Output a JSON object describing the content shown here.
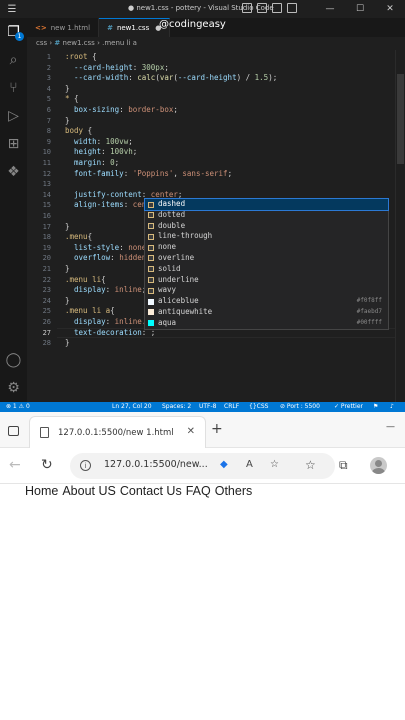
{
  "vscode": {
    "title": "● new1.css - pottery - Visual Studio Code",
    "tabs": [
      {
        "name": "new 1.html",
        "active": false
      },
      {
        "name": "new1.css",
        "active": true
      }
    ],
    "overlay_handle": "@codingeasy",
    "breadcrumb": [
      "css",
      "new1.css",
      ".menu li a"
    ],
    "lines": [
      {
        "n": "1",
        "html": "<span class='sel'>:root</span> <span class='w'>{</span>"
      },
      {
        "n": "2",
        "html": "  <span class='p'>--card-height</span><span class='w'>: </span><span class='n'>300px</span><span class='w'>;</span>"
      },
      {
        "n": "3",
        "html": "  <span class='p'>--card-width</span><span class='w'>: </span><span class='f'>calc</span><span class='w'>(</span><span class='f'>var</span><span class='w'>(</span><span class='p'>--card-height</span><span class='w'>) / </span><span class='n'>1.5</span><span class='w'>);</span>"
      },
      {
        "n": "4",
        "html": "<span class='w'>}</span>"
      },
      {
        "n": "5",
        "html": "<span class='sel'>*</span> <span class='w'>{</span>"
      },
      {
        "n": "6",
        "html": "  <span class='p'>box-sizing</span><span class='w'>: </span><span class='v'>border-box</span><span class='w'>;</span>"
      },
      {
        "n": "7",
        "html": "<span class='w'>}</span>"
      },
      {
        "n": "8",
        "html": "<span class='sel'>body</span> <span class='w'>{</span>"
      },
      {
        "n": "9",
        "html": "  <span class='p'>width</span><span class='w'>: </span><span class='n'>100vw</span><span class='w'>;</span>"
      },
      {
        "n": "10",
        "html": "  <span class='p'>height</span><span class='w'>: </span><span class='n'>100vh</span><span class='w'>;</span>"
      },
      {
        "n": "11",
        "html": "  <span class='p'>margin</span><span class='w'>: </span><span class='n'>0</span><span class='w'>;</span>"
      },
      {
        "n": "12",
        "html": "  <span class='p'>font-family</span><span class='w'>: </span><span class='s'>'Poppins'</span><span class='w'>, </span><span class='v'>sans-serif</span><span class='w'>;</span>"
      },
      {
        "n": "13",
        "html": ""
      },
      {
        "n": "14",
        "html": "  <span class='p'>justify-content</span><span class='w'>: </span><span class='v'>center</span><span class='w'>;</span>"
      },
      {
        "n": "15",
        "html": "  <span class='p'>align-items</span><span class='w'>: </span><span class='v'>cen</span>"
      },
      {
        "n": "16",
        "html": ""
      },
      {
        "n": "17",
        "html": "<span class='w'>}</span>"
      },
      {
        "n": "18",
        "html": "<span class='sel'>.menu</span><span class='w'>{</span>"
      },
      {
        "n": "19",
        "html": "  <span class='p'>list-style</span><span class='w'>: </span><span class='v'>none</span>"
      },
      {
        "n": "20",
        "html": "  <span class='p'>overflow</span><span class='w'>: </span><span class='v'>hidden</span>"
      },
      {
        "n": "21",
        "html": "<span class='w'>}</span>"
      },
      {
        "n": "22",
        "html": "<span class='sel'>.menu li</span><span class='w'>{</span>"
      },
      {
        "n": "23",
        "html": "  <span class='p'>display</span><span class='w'>: </span><span class='v'>inline</span><span class='w'>;</span>"
      },
      {
        "n": "24",
        "html": "<span class='w'>}</span>"
      },
      {
        "n": "25",
        "html": "<span class='sel'>.menu li a</span><span class='w'>{</span>"
      },
      {
        "n": "26",
        "html": "  <span class='p'>display</span><span class='w'>: </span><span class='v'>inline.</span>"
      },
      {
        "n": "27",
        "html": "  <span class='p'>text-decoration</span><span class='w'>: ;</span>"
      },
      {
        "n": "28",
        "html": "<span class='w'>}</span>"
      }
    ],
    "current_line": 27,
    "suggestions": [
      {
        "label": "dashed",
        "kind": "keyword",
        "focus": true
      },
      {
        "label": "dotted",
        "kind": "keyword"
      },
      {
        "label": "double",
        "kind": "keyword"
      },
      {
        "label": "line-through",
        "kind": "keyword"
      },
      {
        "label": "none",
        "kind": "keyword"
      },
      {
        "label": "overline",
        "kind": "keyword"
      },
      {
        "label": "solid",
        "kind": "keyword"
      },
      {
        "label": "underline",
        "kind": "keyword"
      },
      {
        "label": "wavy",
        "kind": "keyword"
      },
      {
        "label": "aliceblue",
        "kind": "color",
        "hex": "#f0f8ff",
        "swatch": "#f0f8ff"
      },
      {
        "label": "antiquewhite",
        "kind": "color",
        "hex": "#faebd7",
        "swatch": "#faebd7"
      },
      {
        "label": "aqua",
        "kind": "color",
        "hex": "#00ffff",
        "swatch": "#00ffff"
      }
    ],
    "status": {
      "problems": "⊗ 1 ⚠ 0",
      "position": "Ln 27, Col 20",
      "spaces": "Spaces: 2",
      "encoding": "UTF-8",
      "eol": "CRLF",
      "language": "CSS",
      "port": "⊘ Port : 5500",
      "prettier": "✓ Prettier"
    },
    "colors": {
      "accent": "#0078d4",
      "editor_bg": "#1f1f1f"
    }
  },
  "browser": {
    "tab_title": "127.0.0.1:5500/new 1.html",
    "url": "127.0.0.1:5500/new...",
    "menu_items": [
      "Home",
      "About US",
      "Contact Us",
      "FAQ",
      "Others"
    ]
  }
}
